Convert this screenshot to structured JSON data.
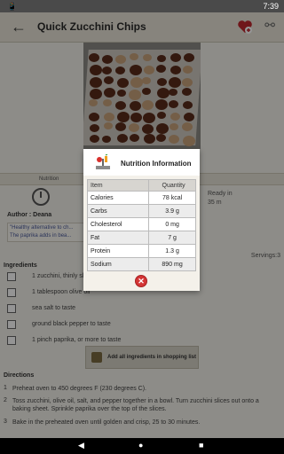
{
  "status_bar": {
    "left_icons": "📱",
    "time": "7:39"
  },
  "app_bar": {
    "title": "Quick Zucchini Chips"
  },
  "recipe": {
    "tabs": [
      "Nutrition"
    ],
    "ready_in_label": "Ready in",
    "ready_in_value": "35 m",
    "author": "Author : Deana",
    "description": "\"Healthy alternative to ch... The paprika adds in bea...",
    "servings": "Servings:3"
  },
  "ingredients": {
    "heading": "Ingredients",
    "items": [
      "1 zucchini, thinly slice...",
      "1 tablespoon olive oil",
      "sea salt to taste",
      "ground black pepper to taste",
      "1 pinch paprika, or more to taste"
    ],
    "add_all_label": "Add all ingredients in shopping list"
  },
  "directions": {
    "heading": "Directions",
    "steps": [
      {
        "num": "1",
        "text": "Preheat oven to 450 degrees F (230 degrees C)."
      },
      {
        "num": "2",
        "text": "Toss zucchini, olive oil, salt, and pepper together in a bowl. Turn zucchini slices out onto a baking sheet. Sprinkle paprika over the top of the slices."
      },
      {
        "num": "3",
        "text": "Bake in the preheated oven until golden and crisp, 25 to 30 minutes."
      }
    ]
  },
  "dialog": {
    "title": "Nutrition Information",
    "col_item": "Item",
    "col_quantity": "Quantity",
    "rows": [
      {
        "item": "Calories",
        "quantity": "78 kcal"
      },
      {
        "item": "Carbs",
        "quantity": "3.9 g"
      },
      {
        "item": "Cholesterol",
        "quantity": "0 mg"
      },
      {
        "item": "Fat",
        "quantity": "7 g"
      },
      {
        "item": "Protein",
        "quantity": "1.3 g"
      },
      {
        "item": "Sodium",
        "quantity": "890 mg"
      }
    ],
    "close_glyph": "✕",
    "icon": "nutrition-scale-icon"
  },
  "nav": {
    "back": "◀",
    "home": "●",
    "recents": "■"
  },
  "colors": {
    "close_red": "#d43535",
    "dim_overlay": "rgba(0,0,0,0.42)"
  }
}
